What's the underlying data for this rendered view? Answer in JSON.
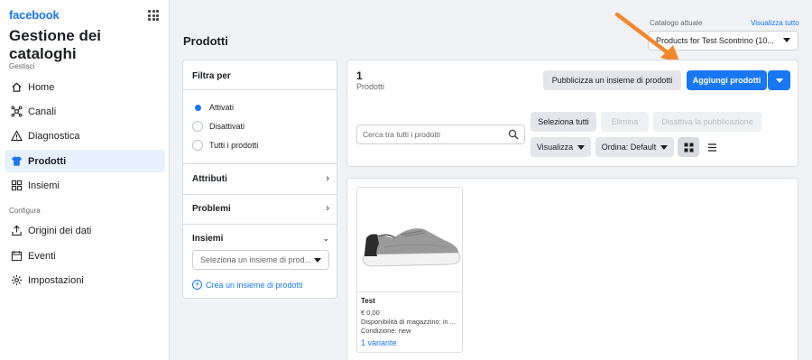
{
  "brand": "facebook",
  "app_title": "Gestione dei cataloghi",
  "sidebar": {
    "manage_label": "Gestisci",
    "manage_items": [
      {
        "label": "Home",
        "icon": "home-icon"
      },
      {
        "label": "Canali",
        "icon": "channels-icon"
      },
      {
        "label": "Diagnostica",
        "icon": "warning-icon"
      },
      {
        "label": "Prodotti",
        "icon": "shirt-icon",
        "active": true
      },
      {
        "label": "Insiemi",
        "icon": "sets-icon"
      }
    ],
    "config_label": "Configura",
    "config_items": [
      {
        "label": "Origini dei dati",
        "icon": "upload-icon"
      },
      {
        "label": "Eventi",
        "icon": "calendar-icon"
      },
      {
        "label": "Impostazioni",
        "icon": "gear-icon"
      }
    ]
  },
  "header": {
    "page_title": "Prodotti",
    "catalog_label": "Catalogo attuale",
    "catalog_link": "Visualizza tutto",
    "catalog_value": "Products for Test Scontrino (10..."
  },
  "filter": {
    "title": "Filtra per",
    "status_options": [
      {
        "label": "Attivati",
        "selected": true
      },
      {
        "label": "Disattivati",
        "selected": false
      },
      {
        "label": "Tutti i prodotti",
        "selected": false
      }
    ],
    "sections": [
      "Attributi",
      "Problemi",
      "Insiemi"
    ],
    "set_placeholder": "Seleziona un insieme di prod...",
    "create_set": "Crea un insieme di prodotti"
  },
  "toolbar": {
    "count": "1",
    "count_label": "Prodotti",
    "publish_set": "Pubblicizza un insieme di prodotti",
    "add_products": "Aggiungi prodotti",
    "search_placeholder": "Cerca tra tutti i prodotti",
    "select_all": "Seleziona tutti",
    "delete": "Elimina",
    "unpublish": "Disattiva la pubblicazione",
    "view": "Visualizza",
    "sort": "Ordina: Default"
  },
  "products": [
    {
      "name": "Test",
      "price": "€ 0,00",
      "availability": "Disponibilità di magazzino: in ...",
      "condition": "Condizione: new",
      "variants": "1 variante"
    }
  ],
  "colors": {
    "accent": "#1877f2",
    "arrow": "#f4862b"
  }
}
